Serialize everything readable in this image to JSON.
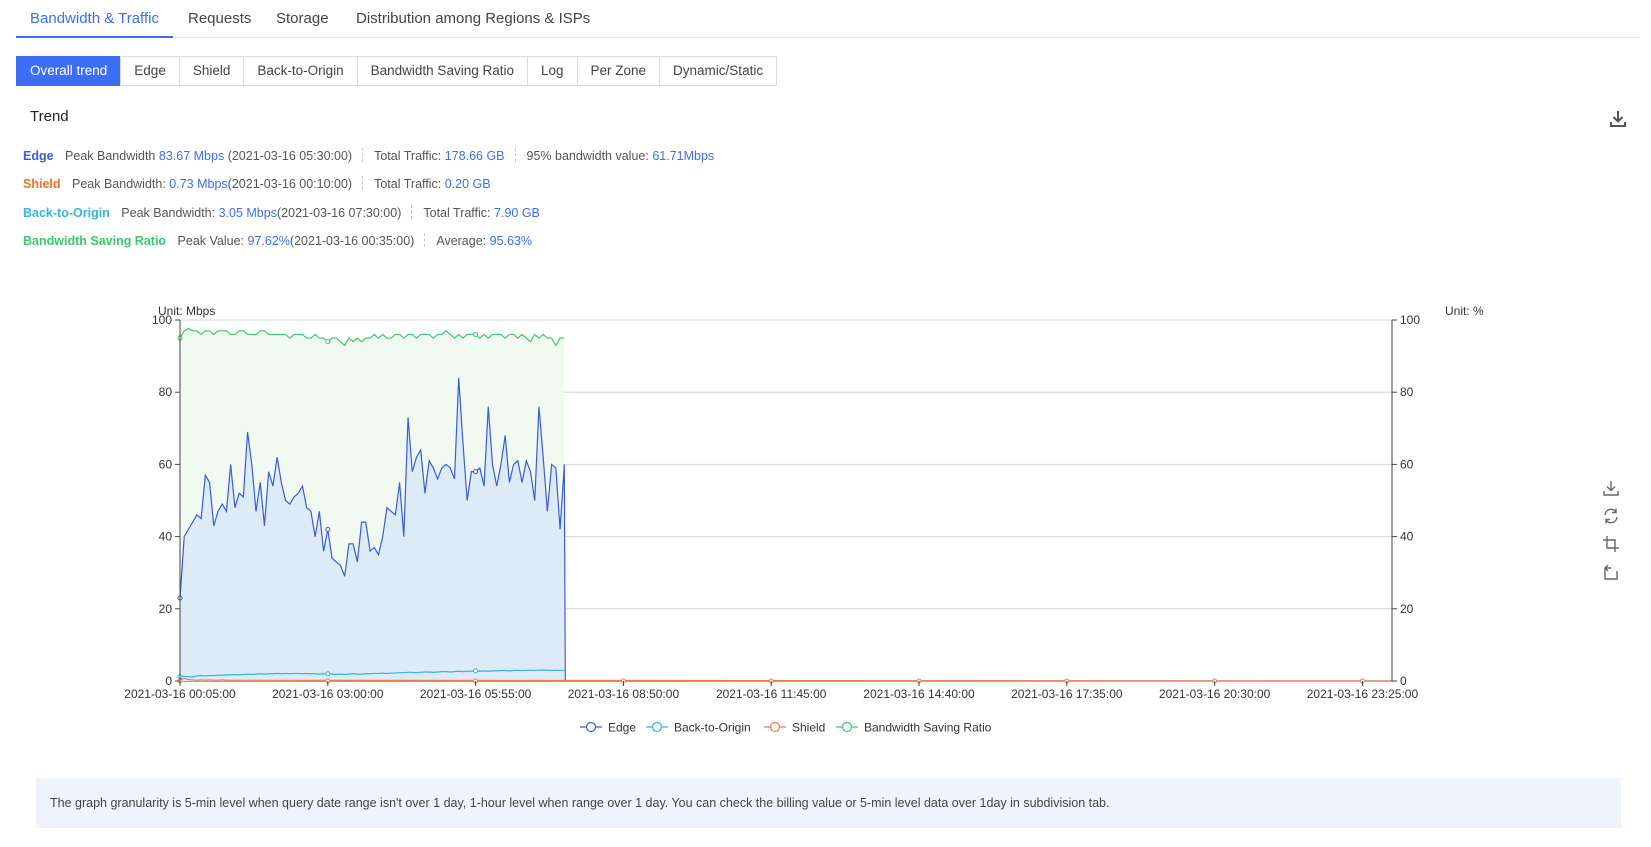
{
  "main_tabs": [
    {
      "label": "Bandwidth & Traffic",
      "active": true
    },
    {
      "label": "Requests",
      "active": false
    },
    {
      "label": "Storage",
      "active": false
    },
    {
      "label": "Distribution among Regions & ISPs",
      "active": false
    }
  ],
  "sub_tabs": [
    {
      "label": "Overall trend",
      "active": true
    },
    {
      "label": "Edge",
      "active": false
    },
    {
      "label": "Shield",
      "active": false
    },
    {
      "label": "Back-to-Origin",
      "active": false
    },
    {
      "label": "Bandwidth Saving Ratio",
      "active": false
    },
    {
      "label": "Log",
      "active": false
    },
    {
      "label": "Per Zone",
      "active": false
    },
    {
      "label": "Dynamic/Static",
      "active": false
    }
  ],
  "trend_title": "Trend",
  "icons": {
    "download": "download-icon",
    "save_image": "save-image-icon",
    "restore": "restore-icon",
    "zoom": "zoom-icon",
    "zoom_back": "zoom-back-icon"
  },
  "summary": {
    "edge": {
      "name": "Edge",
      "color": "#3b5bdb",
      "peak_label": "Peak Bandwidth",
      "peak_value": "83.67 Mbps",
      "peak_time": "(2021-03-16 05:30:00)",
      "traffic_label": "Total Traffic:",
      "traffic_value": "178.66 GB",
      "p95_label": "95% bandwidth value:",
      "p95_value": "61.71Mbps"
    },
    "shield": {
      "name": "Shield",
      "color": "#f07020",
      "peak_label": "Peak Bandwidth:",
      "peak_value": "0.73 Mbps",
      "peak_time": "(2021-03-16 00:10:00)",
      "traffic_label": "Total Traffic:",
      "traffic_value": "0.20 GB"
    },
    "origin": {
      "name": "Back-to-Origin",
      "color": "#33b5e5",
      "peak_label": "Peak Bandwidth:",
      "peak_value": "3.05 Mbps",
      "peak_time": "(2021-03-16 07:30:00)",
      "traffic_label": "Total Traffic:",
      "traffic_value": "7.90 GB"
    },
    "ratio": {
      "name": "Bandwidth Saving Ratio",
      "color": "#3cc96a",
      "peak_label": "Peak Value:",
      "peak_value": "97.62%",
      "peak_time": "(2021-03-16 00:35:00)",
      "avg_label": "Average:",
      "avg_value": "95.63%"
    }
  },
  "chart_data": {
    "type": "line",
    "left_unit": "Unit: Mbps",
    "right_unit": "Unit: %",
    "ylim": [
      0,
      100
    ],
    "ylim_right": [
      0,
      100
    ],
    "y_ticks": [
      0,
      20,
      40,
      60,
      80,
      100
    ],
    "x_labels": [
      "2021-03-16 00:05:00",
      "2021-03-16 03:00:00",
      "2021-03-16 05:55:00",
      "2021-03-16 08:50:00",
      "2021-03-16 11:45:00",
      "2021-03-16 14:40:00",
      "2021-03-16 17:35:00",
      "2021-03-16 20:30:00",
      "2021-03-16 23:25:00"
    ],
    "interval_minutes": 5,
    "points_total": 288,
    "legend_position": "bottom-center",
    "grid": true,
    "series": [
      {
        "name": "Edge",
        "color": "#3b5bdb",
        "fill": "#dcebf5",
        "axis": "left",
        "values": [
          23,
          40,
          42,
          44,
          46,
          45,
          57,
          55,
          43,
          47,
          49,
          47,
          60,
          48,
          52,
          51,
          69,
          60,
          47,
          55,
          43,
          58,
          54,
          62,
          55,
          50,
          49,
          51,
          52,
          54,
          48,
          47,
          40,
          47,
          36,
          42,
          34,
          33,
          32,
          29,
          38,
          38,
          33,
          44,
          44,
          36,
          37,
          35,
          40,
          48,
          47,
          46,
          55,
          40,
          73,
          58,
          62,
          64,
          52,
          61,
          59,
          56,
          59,
          60,
          59,
          56,
          84,
          66,
          50,
          58,
          58,
          59,
          54,
          76,
          60,
          54,
          60,
          68,
          55,
          60,
          61,
          55,
          61,
          58,
          50,
          76,
          62,
          47,
          60,
          59,
          42,
          60
        ],
        "drop_to": 0
      },
      {
        "name": "Back-to-Origin",
        "color": "#33b5e5",
        "axis": "left",
        "values": [
          1.2,
          1.3,
          1.2,
          1.1,
          1.4,
          1.5,
          1.4,
          1.5,
          1.5,
          1.6,
          1.6,
          1.7,
          1.7,
          1.8,
          1.7,
          1.8,
          1.9,
          1.8,
          1.9,
          2.0,
          1.9,
          2.0,
          2.0,
          2.1,
          2.0,
          2.1,
          2.0,
          2.1,
          2.1,
          2.0,
          2.1,
          2.0,
          2.0,
          1.9,
          2.0,
          2.0,
          1.9,
          1.8,
          1.9,
          1.8,
          1.9,
          2.0,
          1.9,
          1.9,
          2.0,
          2.0,
          2.1,
          2.1,
          2.2,
          2.1,
          2.2,
          2.2,
          2.3,
          2.3,
          2.4,
          2.4,
          2.3,
          2.4,
          2.5,
          2.5,
          2.4,
          2.5,
          2.6,
          2.6,
          2.5,
          2.6,
          2.7,
          2.6,
          2.7,
          2.7,
          2.8,
          2.7,
          2.8,
          2.7,
          2.8,
          2.8,
          2.9,
          2.9,
          2.8,
          2.9,
          3.0,
          2.9,
          3.0,
          3.0,
          2.9,
          3.0,
          3.05,
          3.0,
          2.9,
          3.0,
          2.9,
          3.0
        ]
      },
      {
        "name": "Shield",
        "color": "#f07a4a",
        "axis": "left",
        "values": [
          0.3,
          0.73,
          0.4,
          0.3,
          0.2,
          0.3,
          0.2,
          0.3,
          0.2,
          0.2,
          0.3,
          0.2
        ],
        "rest": 0
      },
      {
        "name": "Bandwidth Saving Ratio",
        "color": "#3cc96a",
        "fill": "#f1faf1",
        "axis": "right",
        "values": [
          95,
          97,
          97.62,
          97,
          97,
          96,
          97,
          97,
          96,
          97,
          97,
          97,
          96,
          96,
          97,
          97,
          96,
          96,
          96,
          97,
          97,
          96,
          96,
          96,
          96,
          96,
          95,
          96,
          96,
          96,
          95,
          95,
          96,
          95,
          95,
          94,
          95,
          95,
          94,
          93,
          95,
          94,
          95,
          94,
          95,
          95,
          96,
          95,
          96,
          95,
          95,
          96,
          96,
          95,
          96,
          96,
          95,
          96,
          96,
          96,
          95,
          96,
          96,
          97,
          96,
          95,
          96,
          95,
          96,
          96,
          96,
          95,
          96,
          95,
          96,
          96,
          96,
          95,
          96,
          96,
          95,
          96,
          95,
          94,
          96,
          95,
          96,
          95,
          95,
          93,
          95,
          95
        ]
      }
    ]
  },
  "legend": [
    "Edge",
    "Back-to-Origin",
    "Shield",
    "Bandwidth Saving Ratio"
  ],
  "note": "The graph granularity is 5-min level when query date range isn't over 1 day, 1-hour level when range over 1 day. You can check the billing value or 5-min level data over 1day in subdivision tab."
}
